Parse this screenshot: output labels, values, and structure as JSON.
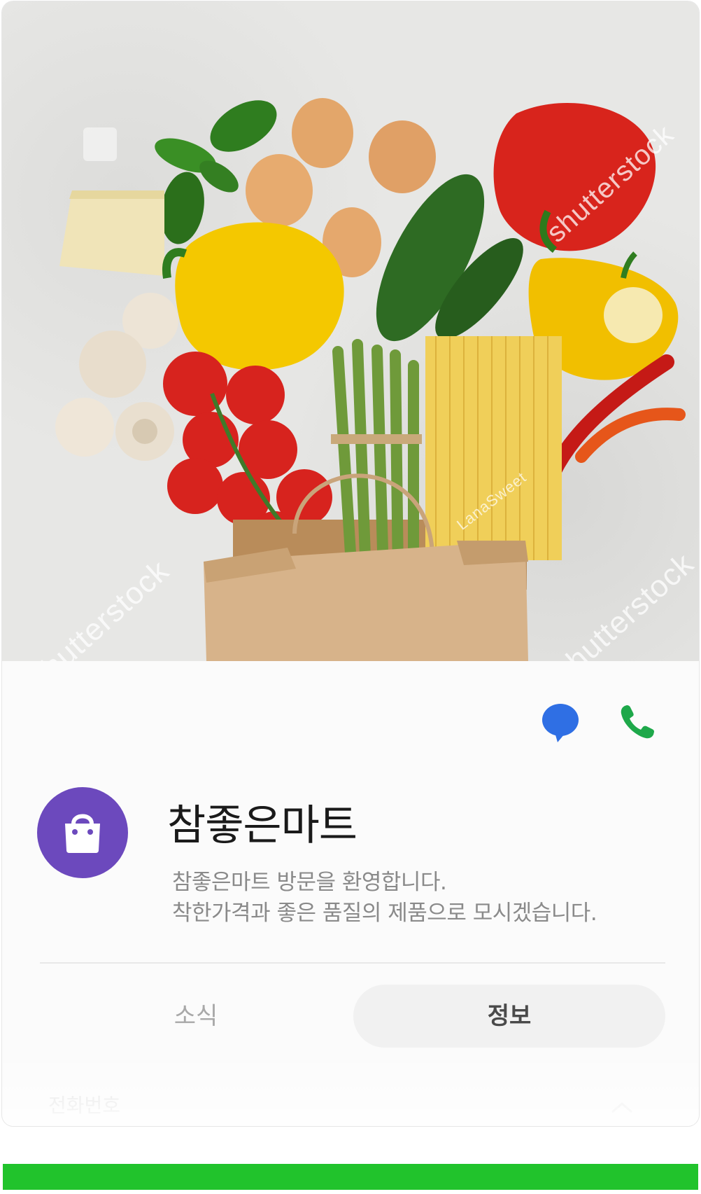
{
  "hero": {
    "description": "",
    "watermarks": [
      "shutterstock",
      "shutterstock",
      "shutterstock",
      "LanaSweet"
    ]
  },
  "actions": {
    "chat_icon": "chat-bubble-icon",
    "call_icon": "phone-icon",
    "chat_color": "#2f6fe4",
    "call_color": "#1ea84a"
  },
  "store": {
    "logo_icon": "shopping-bag-icon",
    "logo_color": "#6c49bd",
    "name": "참좋은마트",
    "description_lines": [
      "참좋은마트  방문을 환영합니다.",
      "착한가격과 좋은 품질의 제품으로 모시겠습니다."
    ]
  },
  "tabs": [
    {
      "label": "소식",
      "selected": false
    },
    {
      "label": "정보",
      "selected": true
    }
  ],
  "details": {
    "phone_label": "전화번호"
  },
  "bottom_bar": {
    "color": "#21c32c"
  }
}
